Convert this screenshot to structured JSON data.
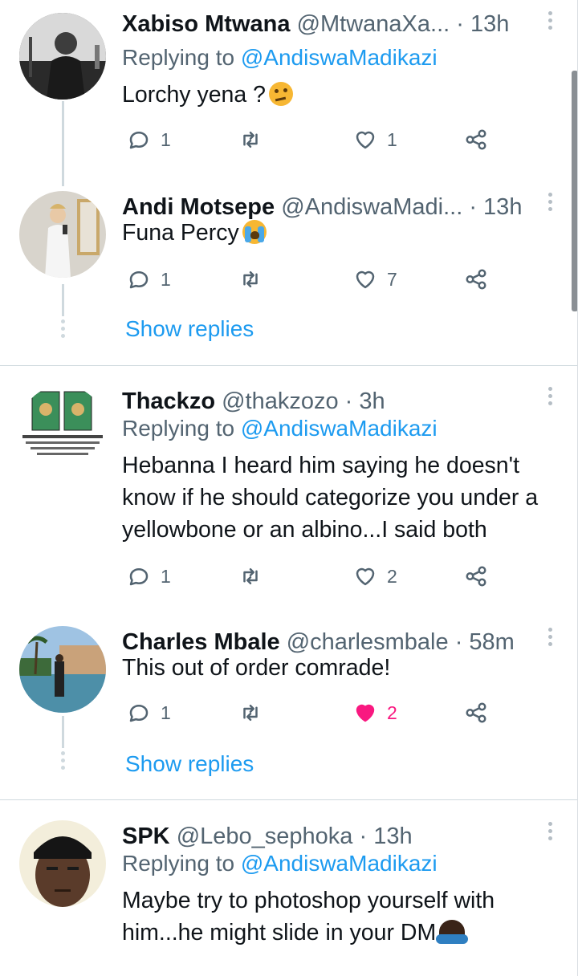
{
  "tweets": [
    {
      "name": "Xabiso Mtwana",
      "handle": "@MtwanaXa...",
      "time": "· 13h",
      "replying_prefix": "Replying to",
      "replying_to": "@AndiswaMadikazi",
      "text": "Lorchy yena ?",
      "emoji": "thinking-face",
      "replies": "1",
      "retweets": "",
      "likes": "1"
    },
    {
      "name": "Andi Motsepe",
      "handle": "@AndiswaMadi...",
      "time": "· 13h",
      "text": "Funa Percy",
      "emoji": "loudly-crying-face",
      "replies": "1",
      "retweets": "",
      "likes": "7",
      "show_replies": "Show replies"
    },
    {
      "name": "Thackzo",
      "handle": "@thakzozo",
      "time": "· 3h",
      "replying_prefix": "Replying to",
      "replying_to": "@AndiswaMadikazi",
      "text": "Hebanna I heard him saying he doesn't know if he should categorize you under a yellowbone or an albino...I said both",
      "replies": "1",
      "retweets": "",
      "likes": "2"
    },
    {
      "name": "Charles Mbale",
      "handle": "@charlesmbale",
      "time": "· 58m",
      "text": "This out of order comrade!",
      "replies": "1",
      "retweets": "",
      "likes": "2",
      "liked": true,
      "show_replies": "Show replies"
    },
    {
      "name": "SPK",
      "handle": "@Lebo_sephoka",
      "time": "· 13h",
      "replying_prefix": "Replying to",
      "replying_to": "@AndiswaMadikazi",
      "text": "Maybe try to photoshop yourself with him...he might slide in your DM",
      "emoji": "person-shrugging"
    }
  ],
  "colors": {
    "link": "#1d9bf0",
    "muted": "#536471",
    "like_active": "#f91880",
    "thread_line": "#cfd9de"
  },
  "icons": [
    "reply-icon",
    "retweet-icon",
    "like-icon",
    "share-icon",
    "more-options-icon"
  ]
}
